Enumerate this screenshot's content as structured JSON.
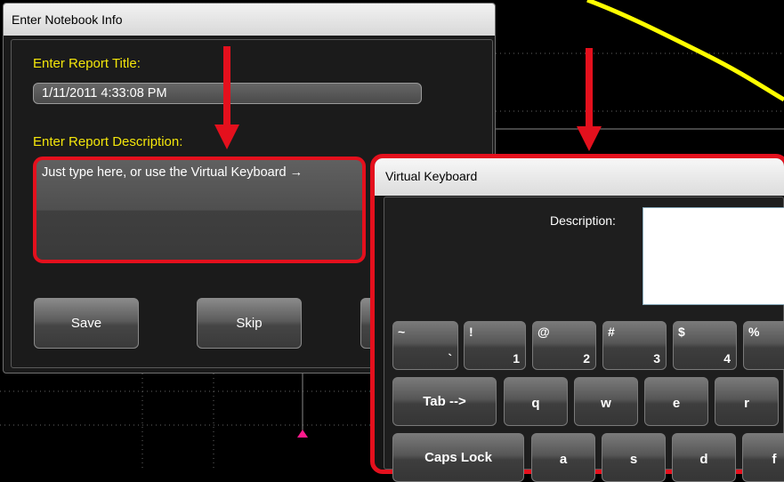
{
  "notebook_dialog": {
    "title": "Enter Notebook Info",
    "report_title_label": "Enter Report Title:",
    "report_title_value": "1/11/2011 4:33:08 PM",
    "report_description_label": "Enter Report Description:",
    "report_description_value": "Just type here, or use the Virtual Keyboard →",
    "buttons": {
      "save": "Save",
      "skip": "Skip"
    }
  },
  "virtual_keyboard": {
    "title": "Virtual Keyboard",
    "description_label": "Description:",
    "description_value": "",
    "row1": [
      {
        "top": "~",
        "bottom": "`"
      },
      {
        "top": "!",
        "bottom": "1"
      },
      {
        "top": "@",
        "bottom": "2"
      },
      {
        "top": "#",
        "bottom": "3"
      },
      {
        "top": "$",
        "bottom": "4"
      },
      {
        "top": "%",
        "bottom": ""
      }
    ],
    "row2": [
      "Tab -->",
      "q",
      "w",
      "e",
      "r"
    ],
    "row3": [
      "Caps Lock",
      "a",
      "s",
      "d",
      "f"
    ]
  },
  "colors": {
    "highlight_red": "#e4101d",
    "label_yellow": "#f4e60b",
    "trace_yellow": "#ffff00",
    "trigger_marker_magenta": "#ff1a8c"
  },
  "icons": [
    "down-arrow-annotation-icon",
    "trigger-marker-icon"
  ]
}
